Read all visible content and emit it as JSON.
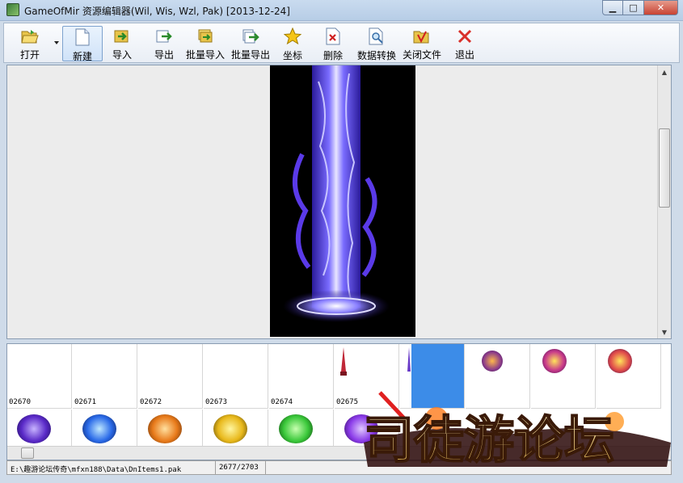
{
  "window": {
    "title": "GameOfMir 资源编辑器(Wil, Wis, Wzl, Pak) [2013-12-24]"
  },
  "toolbar": {
    "open": "打开",
    "new": "新建",
    "import": "导入",
    "export": "导出",
    "batch_import": "批量导入",
    "batch_export": "批量导出",
    "coords": "坐标",
    "delete": "删除",
    "convert": "数据转换",
    "close_file": "关闭文件",
    "exit": "退出"
  },
  "grid": {
    "row1": [
      "02670",
      "02671",
      "02672",
      "02673",
      "02674",
      "02675"
    ]
  },
  "status": {
    "path": "E:\\趣游论坛传奇\\mfxn188\\Data\\DnItems1.pak",
    "index": "2677/2703"
  },
  "watermark": {
    "text": "司徒游论坛"
  },
  "colors": {
    "accent": "#3c8ce8",
    "close": "#d9302a"
  }
}
